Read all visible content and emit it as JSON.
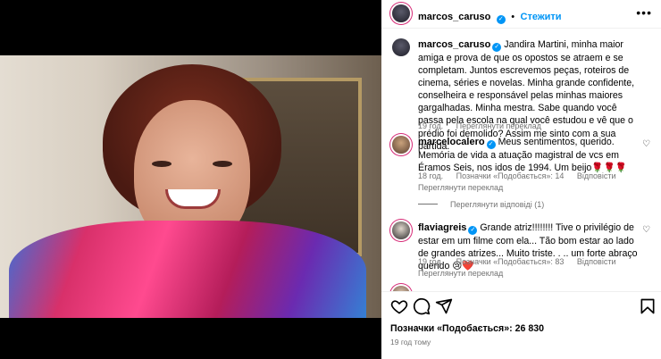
{
  "post": {
    "username": "marcos_caruso",
    "follow_label": "Стежити",
    "caption": "Jandira Martini, minha maior amiga e prova de que os opostos se atraem e se completam. Juntos escrevemos peças, roteiros de cinema, séries e novelas. Minha grande confidente, conselheira e responsável pelas minhas maiores gargalhadas. Minha mestra. Sabe quando você passa pela escola na qual você estudou e vê que o prédio foi demolido? Assim me sinto com a sua partida.",
    "caption_time": "19 год.",
    "caption_translate": "Переглянути переклад",
    "likes_text": "Позначки «Подобається»: 26 830",
    "time_ago": "19 год тому"
  },
  "comments": [
    {
      "username": "marcelocalero",
      "text": "Meus sentimentos, querido. Memória de vida a atuação magistral de vcs em Éramos Seis, nos idos de 1994. Um beijo🌹🌹🌹",
      "time": "18 год.",
      "likes": "Позначки «Подобається»: 14",
      "reply": "Відповісти",
      "translate": "Переглянути переклад",
      "view_replies": "Переглянути відповіді (1)"
    },
    {
      "username": "flaviagreis",
      "text": "Grande atriz!!!!!!!! Tive o privilégio de estar em um filme com ela... Tão bom estar ao lado de grandes atrizes... Muito triste. . .. um forte abraço querido 😢❤️",
      "time": "19 год.",
      "likes": "Позначки «Подобається»: 83",
      "reply": "Відповісти",
      "translate": "Переглянути переклад"
    }
  ],
  "icons": {
    "more": "more-options-icon",
    "heart": "heart-icon",
    "comment": "comment-icon",
    "share": "share-icon",
    "save": "bookmark-icon",
    "verified": "verified-badge-icon"
  },
  "colors": {
    "accent": "#0095f6",
    "muted": "#737373",
    "border": "#efefef",
    "like": "#ed4956"
  }
}
